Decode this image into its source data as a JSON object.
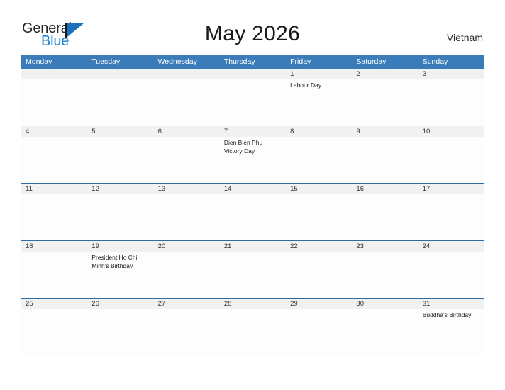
{
  "brand": {
    "name_part1": "General",
    "name_part2": "Blue",
    "flag_icon": "triangle-flag-icon",
    "accent_color": "#1c7fd0"
  },
  "header": {
    "title": "May 2026",
    "country": "Vietnam"
  },
  "theme": {
    "header_bar_color": "#3a7cba",
    "week_separator_color": "#2e6da4",
    "day_strip_color": "#f1f1f1",
    "cell_background": "#fdfdfd"
  },
  "calendar": {
    "weekdays": [
      "Monday",
      "Tuesday",
      "Wednesday",
      "Thursday",
      "Friday",
      "Saturday",
      "Sunday"
    ],
    "weeks": [
      [
        {
          "num": "",
          "events": []
        },
        {
          "num": "",
          "events": []
        },
        {
          "num": "",
          "events": []
        },
        {
          "num": "",
          "events": []
        },
        {
          "num": "1",
          "events": [
            "Labour Day"
          ]
        },
        {
          "num": "2",
          "events": []
        },
        {
          "num": "3",
          "events": []
        }
      ],
      [
        {
          "num": "4",
          "events": []
        },
        {
          "num": "5",
          "events": []
        },
        {
          "num": "6",
          "events": []
        },
        {
          "num": "7",
          "events": [
            "Dien Bien Phu Victory Day"
          ]
        },
        {
          "num": "8",
          "events": []
        },
        {
          "num": "9",
          "events": []
        },
        {
          "num": "10",
          "events": []
        }
      ],
      [
        {
          "num": "11",
          "events": []
        },
        {
          "num": "12",
          "events": []
        },
        {
          "num": "13",
          "events": []
        },
        {
          "num": "14",
          "events": []
        },
        {
          "num": "15",
          "events": []
        },
        {
          "num": "16",
          "events": []
        },
        {
          "num": "17",
          "events": []
        }
      ],
      [
        {
          "num": "18",
          "events": []
        },
        {
          "num": "19",
          "events": [
            "President Ho Chi Minh's Birthday"
          ]
        },
        {
          "num": "20",
          "events": []
        },
        {
          "num": "21",
          "events": []
        },
        {
          "num": "22",
          "events": []
        },
        {
          "num": "23",
          "events": []
        },
        {
          "num": "24",
          "events": []
        }
      ],
      [
        {
          "num": "25",
          "events": []
        },
        {
          "num": "26",
          "events": []
        },
        {
          "num": "27",
          "events": []
        },
        {
          "num": "28",
          "events": []
        },
        {
          "num": "29",
          "events": []
        },
        {
          "num": "30",
          "events": []
        },
        {
          "num": "31",
          "events": [
            "Buddha's Birthday"
          ]
        }
      ]
    ]
  }
}
